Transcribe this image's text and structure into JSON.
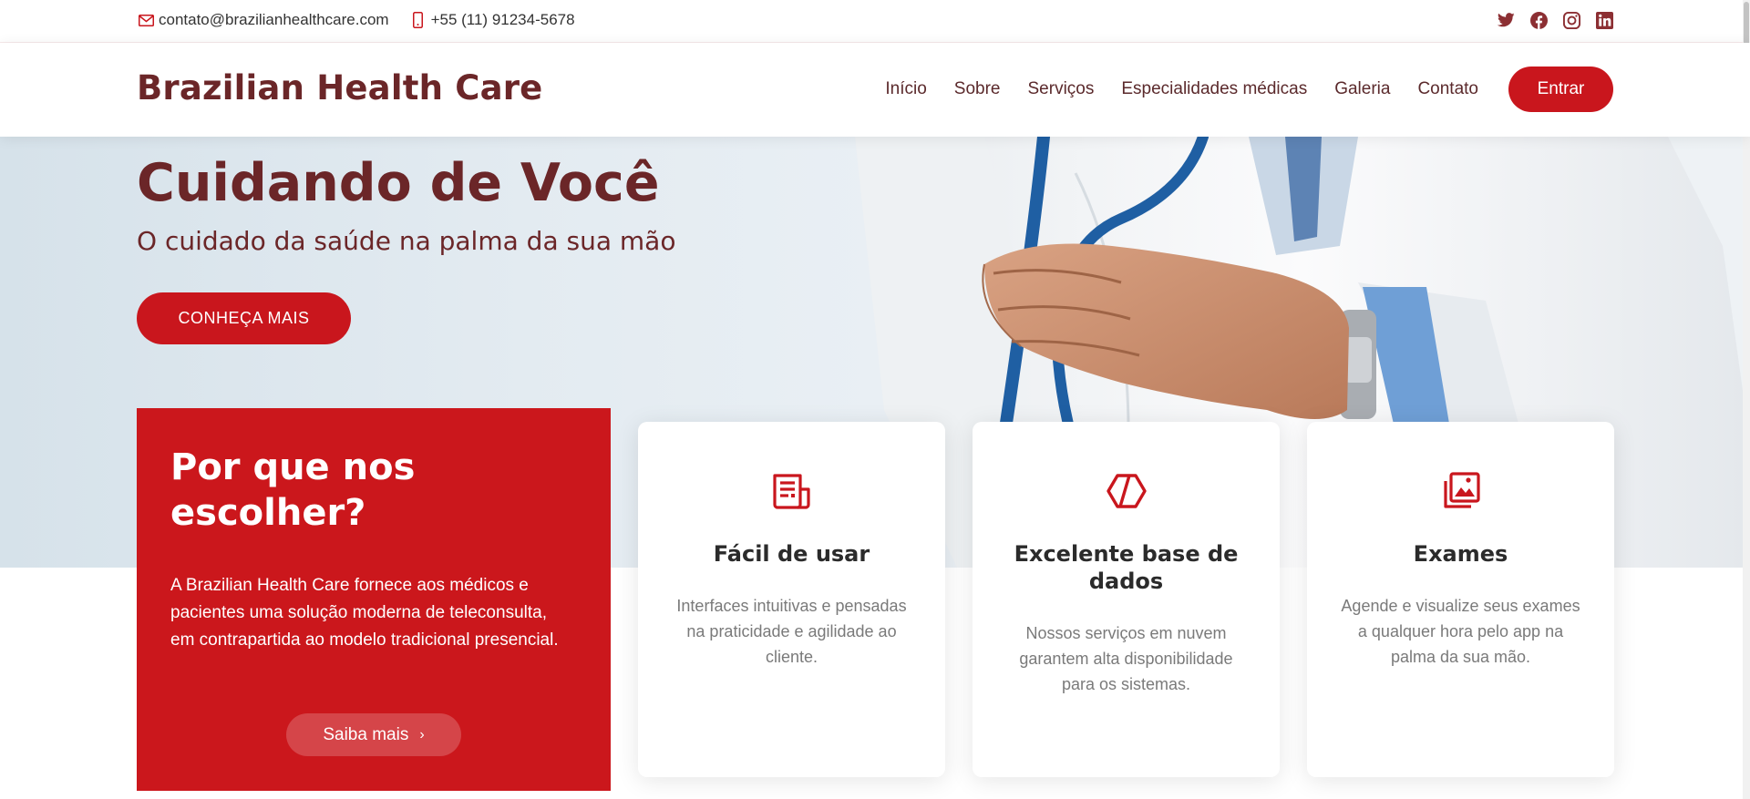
{
  "topbar": {
    "email": "contato@brazilianhealthcare.com",
    "phone": "+55 (11) 91234-5678",
    "social_icons": [
      "twitter-icon",
      "facebook-icon",
      "instagram-icon",
      "linkedin-icon"
    ]
  },
  "header": {
    "logo": "Brazilian Health Care",
    "nav": [
      "Início",
      "Sobre",
      "Serviços",
      "Especialidades médicas",
      "Galeria",
      "Contato"
    ],
    "login_label": "Entrar"
  },
  "hero": {
    "title": "Cuidando de Você",
    "subtitle": "O cuidado da saúde na palma da sua mão",
    "cta_label": "CONHEÇA MAIS"
  },
  "why": {
    "title": "Por que nos escolher?",
    "text": "A Brazilian Health Care fornece aos médicos e pacientes uma solução moderna de teleconsulta, em contrapartida ao modelo tradicional presencial.",
    "button_label": "Saiba mais"
  },
  "features": [
    {
      "icon": "document-icon",
      "title": "Fácil de usar",
      "text": "Interfaces intuitivas e pensadas na praticidade e agilidade ao cliente."
    },
    {
      "icon": "hexagon-icon",
      "title": "Excelente base de dados",
      "text": "Nossos serviços em nuvem garantem alta disponibilidade para os sistemas."
    },
    {
      "icon": "images-icon",
      "title": "Exames",
      "text": "Agende e visualize seus exames a qualquer hora pelo app na palma da sua mão."
    }
  ],
  "colors": {
    "brand_red": "#c9161d",
    "brand_dark": "#6b2628"
  }
}
